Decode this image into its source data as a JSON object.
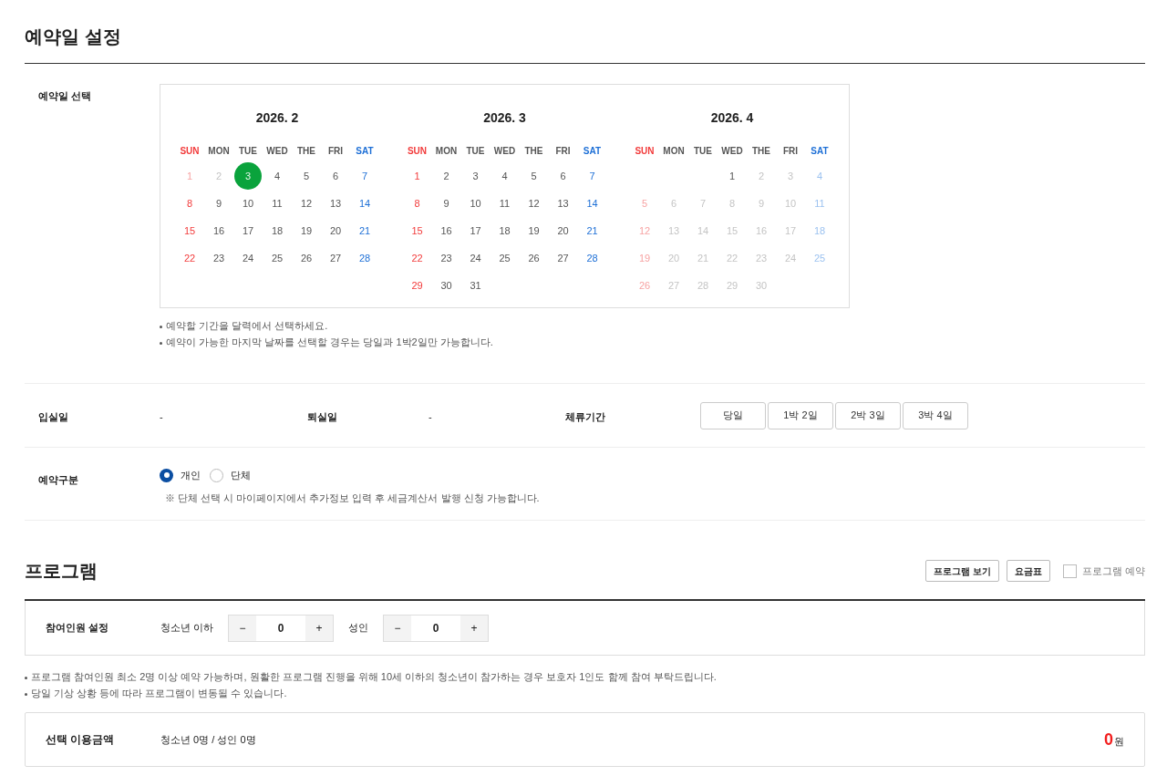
{
  "reservation": {
    "title": "예약일 설정",
    "date_label": "예약일 선택",
    "months": [
      {
        "title": "2026. 2",
        "weekdays": [
          "SUN",
          "MON",
          "TUE",
          "WED",
          "THE",
          "FRI",
          "SAT"
        ],
        "weeks": [
          [
            {
              "kind": "day",
              "day": "1",
              "disabled": true,
              "selected": false
            },
            {
              "kind": "day",
              "day": "2",
              "disabled": true,
              "selected": false
            },
            {
              "kind": "day",
              "day": "3",
              "disabled": false,
              "selected": true
            },
            {
              "kind": "day",
              "day": "4",
              "disabled": false,
              "selected": false
            },
            {
              "kind": "day",
              "day": "5",
              "disabled": false,
              "selected": false
            },
            {
              "kind": "day",
              "day": "6",
              "disabled": false,
              "selected": false
            },
            {
              "kind": "day",
              "day": "7",
              "disabled": false,
              "selected": false
            }
          ],
          [
            {
              "kind": "day",
              "day": "8",
              "disabled": false,
              "selected": false
            },
            {
              "kind": "day",
              "day": "9",
              "disabled": false,
              "selected": false
            },
            {
              "kind": "day",
              "day": "10",
              "disabled": false,
              "selected": false
            },
            {
              "kind": "day",
              "day": "11",
              "disabled": false,
              "selected": false
            },
            {
              "kind": "day",
              "day": "12",
              "disabled": false,
              "selected": false
            },
            {
              "kind": "day",
              "day": "13",
              "disabled": false,
              "selected": false
            },
            {
              "kind": "day",
              "day": "14",
              "disabled": false,
              "selected": false
            }
          ],
          [
            {
              "kind": "day",
              "day": "15",
              "disabled": false,
              "selected": false
            },
            {
              "kind": "day",
              "day": "16",
              "disabled": false,
              "selected": false
            },
            {
              "kind": "day",
              "day": "17",
              "disabled": false,
              "selected": false
            },
            {
              "kind": "day",
              "day": "18",
              "disabled": false,
              "selected": false
            },
            {
              "kind": "day",
              "day": "19",
              "disabled": false,
              "selected": false
            },
            {
              "kind": "day",
              "day": "20",
              "disabled": false,
              "selected": false
            },
            {
              "kind": "day",
              "day": "21",
              "disabled": false,
              "selected": false
            }
          ],
          [
            {
              "kind": "day",
              "day": "22",
              "disabled": false,
              "selected": false
            },
            {
              "kind": "day",
              "day": "23",
              "disabled": false,
              "selected": false
            },
            {
              "kind": "day",
              "day": "24",
              "disabled": false,
              "selected": false
            },
            {
              "kind": "day",
              "day": "25",
              "disabled": false,
              "selected": false
            },
            {
              "kind": "day",
              "day": "26",
              "disabled": false,
              "selected": false
            },
            {
              "kind": "day",
              "day": "27",
              "disabled": false,
              "selected": false
            },
            {
              "kind": "day",
              "day": "28",
              "disabled": false,
              "selected": false
            }
          ]
        ]
      },
      {
        "title": "2026. 3",
        "weekdays": [
          "SUN",
          "MON",
          "TUE",
          "WED",
          "THE",
          "FRI",
          "SAT"
        ],
        "weeks": [
          [
            {
              "kind": "day",
              "day": "1",
              "disabled": false,
              "selected": false
            },
            {
              "kind": "day",
              "day": "2",
              "disabled": false,
              "selected": false
            },
            {
              "kind": "day",
              "day": "3",
              "disabled": false,
              "selected": false
            },
            {
              "kind": "day",
              "day": "4",
              "disabled": false,
              "selected": false
            },
            {
              "kind": "day",
              "day": "5",
              "disabled": false,
              "selected": false
            },
            {
              "kind": "day",
              "day": "6",
              "disabled": false,
              "selected": false
            },
            {
              "kind": "day",
              "day": "7",
              "disabled": false,
              "selected": false
            }
          ],
          [
            {
              "kind": "day",
              "day": "8",
              "disabled": false,
              "selected": false
            },
            {
              "kind": "day",
              "day": "9",
              "disabled": false,
              "selected": false
            },
            {
              "kind": "day",
              "day": "10",
              "disabled": false,
              "selected": false
            },
            {
              "kind": "day",
              "day": "11",
              "disabled": false,
              "selected": false
            },
            {
              "kind": "day",
              "day": "12",
              "disabled": false,
              "selected": false
            },
            {
              "kind": "day",
              "day": "13",
              "disabled": false,
              "selected": false
            },
            {
              "kind": "day",
              "day": "14",
              "disabled": false,
              "selected": false
            }
          ],
          [
            {
              "kind": "day",
              "day": "15",
              "disabled": false,
              "selected": false
            },
            {
              "kind": "day",
              "day": "16",
              "disabled": false,
              "selected": false
            },
            {
              "kind": "day",
              "day": "17",
              "disabled": false,
              "selected": false
            },
            {
              "kind": "day",
              "day": "18",
              "disabled": false,
              "selected": false
            },
            {
              "kind": "day",
              "day": "19",
              "disabled": false,
              "selected": false
            },
            {
              "kind": "day",
              "day": "20",
              "disabled": false,
              "selected": false
            },
            {
              "kind": "day",
              "day": "21",
              "disabled": false,
              "selected": false
            }
          ],
          [
            {
              "kind": "day",
              "day": "22",
              "disabled": false,
              "selected": false
            },
            {
              "kind": "day",
              "day": "23",
              "disabled": false,
              "selected": false
            },
            {
              "kind": "day",
              "day": "24",
              "disabled": false,
              "selected": false
            },
            {
              "kind": "day",
              "day": "25",
              "disabled": false,
              "selected": false
            },
            {
              "kind": "day",
              "day": "26",
              "disabled": false,
              "selected": false
            },
            {
              "kind": "day",
              "day": "27",
              "disabled": false,
              "selected": false
            },
            {
              "kind": "day",
              "day": "28",
              "disabled": false,
              "selected": false
            }
          ],
          [
            {
              "kind": "day",
              "day": "29",
              "disabled": false,
              "selected": false
            },
            {
              "kind": "day",
              "day": "30",
              "disabled": false,
              "selected": false
            },
            {
              "kind": "day",
              "day": "31",
              "disabled": false,
              "selected": false
            },
            {
              "kind": "empty"
            },
            {
              "kind": "empty"
            },
            {
              "kind": "empty"
            },
            {
              "kind": "empty"
            }
          ]
        ]
      },
      {
        "title": "2026. 4",
        "weekdays": [
          "SUN",
          "MON",
          "TUE",
          "WED",
          "THE",
          "FRI",
          "SAT"
        ],
        "weeks": [
          [
            {
              "kind": "empty"
            },
            {
              "kind": "empty"
            },
            {
              "kind": "empty"
            },
            {
              "kind": "day",
              "day": "1",
              "disabled": false,
              "selected": false
            },
            {
              "kind": "day",
              "day": "2",
              "disabled": true,
              "selected": false
            },
            {
              "kind": "day",
              "day": "3",
              "disabled": true,
              "selected": false
            },
            {
              "kind": "day",
              "day": "4",
              "disabled": true,
              "selected": false
            }
          ],
          [
            {
              "kind": "day",
              "day": "5",
              "disabled": true,
              "selected": false
            },
            {
              "kind": "day",
              "day": "6",
              "disabled": true,
              "selected": false
            },
            {
              "kind": "day",
              "day": "7",
              "disabled": true,
              "selected": false
            },
            {
              "kind": "day",
              "day": "8",
              "disabled": true,
              "selected": false
            },
            {
              "kind": "day",
              "day": "9",
              "disabled": true,
              "selected": false
            },
            {
              "kind": "day",
              "day": "10",
              "disabled": true,
              "selected": false
            },
            {
              "kind": "day",
              "day": "11",
              "disabled": true,
              "selected": false
            }
          ],
          [
            {
              "kind": "day",
              "day": "12",
              "disabled": true,
              "selected": false
            },
            {
              "kind": "day",
              "day": "13",
              "disabled": true,
              "selected": false
            },
            {
              "kind": "day",
              "day": "14",
              "disabled": true,
              "selected": false
            },
            {
              "kind": "day",
              "day": "15",
              "disabled": true,
              "selected": false
            },
            {
              "kind": "day",
              "day": "16",
              "disabled": true,
              "selected": false
            },
            {
              "kind": "day",
              "day": "17",
              "disabled": true,
              "selected": false
            },
            {
              "kind": "day",
              "day": "18",
              "disabled": true,
              "selected": false
            }
          ],
          [
            {
              "kind": "day",
              "day": "19",
              "disabled": true,
              "selected": false
            },
            {
              "kind": "day",
              "day": "20",
              "disabled": true,
              "selected": false
            },
            {
              "kind": "day",
              "day": "21",
              "disabled": true,
              "selected": false
            },
            {
              "kind": "day",
              "day": "22",
              "disabled": true,
              "selected": false
            },
            {
              "kind": "day",
              "day": "23",
              "disabled": true,
              "selected": false
            },
            {
              "kind": "day",
              "day": "24",
              "disabled": true,
              "selected": false
            },
            {
              "kind": "day",
              "day": "25",
              "disabled": true,
              "selected": false
            }
          ],
          [
            {
              "kind": "day",
              "day": "26",
              "disabled": true,
              "selected": false
            },
            {
              "kind": "day",
              "day": "27",
              "disabled": true,
              "selected": false
            },
            {
              "kind": "day",
              "day": "28",
              "disabled": true,
              "selected": false
            },
            {
              "kind": "day",
              "day": "29",
              "disabled": true,
              "selected": false
            },
            {
              "kind": "day",
              "day": "30",
              "disabled": true,
              "selected": false
            },
            {
              "kind": "empty"
            },
            {
              "kind": "empty"
            }
          ]
        ]
      }
    ],
    "notes": [
      "예약할 기간을 달력에서 선택하세요.",
      "예약이 가능한 마지막 날짜를 선택할 경우는 당일과 1박2일만 가능합니다."
    ],
    "checkin": {
      "label": "입실일",
      "value": "-"
    },
    "checkout": {
      "label": "퇴실일",
      "value": "-"
    },
    "stay": {
      "label": "체류기간",
      "options": [
        {
          "label": "당일",
          "selected": false
        },
        {
          "label": "1박 2일",
          "selected": false
        },
        {
          "label": "2박 3일",
          "selected": false
        },
        {
          "label": "3박 4일",
          "selected": false
        }
      ]
    },
    "type": {
      "label": "예약구분",
      "options": [
        {
          "label": "개인",
          "selected": true
        },
        {
          "label": "단체",
          "selected": false
        }
      ],
      "note": "※ 단체 선택 시 마이페이지에서 추가정보 입력 후 세금계산서 발행 신청 가능합니다."
    }
  },
  "program": {
    "title": "프로그램",
    "buttons": [
      "프로그램 보기",
      "요금표"
    ],
    "reserve_checkbox": {
      "label": "프로그램 예약",
      "checked": false
    },
    "participants": {
      "label": "참여인원 설정",
      "counters": [
        {
          "label": "청소년 이하",
          "minus": "−",
          "value": "0",
          "plus": "+"
        },
        {
          "label": "성인",
          "minus": "−",
          "value": "0",
          "plus": "+"
        }
      ]
    },
    "notes": [
      "프로그램 참여인원 최소 2명 이상 예약 가능하며, 원활한 프로그램 진행을 위해 10세 이하의 청소년이 참가하는 경우 보호자 1인도 함께 참여 부탁드립니다.",
      "당일 기상 상황 등에 따라 프로그램이 변동될 수 있습니다."
    ],
    "total": {
      "label": "선택 이용금액",
      "summary": "청소년 0명 / 성인 0명",
      "amount": "0",
      "unit": "원"
    }
  }
}
